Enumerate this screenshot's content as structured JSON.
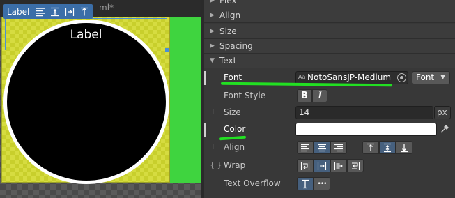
{
  "viewport": {
    "doc_title": "ml*",
    "toolbar_label": "Label",
    "canvas_label": "Label"
  },
  "inspector": {
    "sections": [
      {
        "label": "Flex",
        "expanded": false
      },
      {
        "label": "Align",
        "expanded": false
      },
      {
        "label": "Size",
        "expanded": false
      },
      {
        "label": "Spacing",
        "expanded": false
      },
      {
        "label": "Text",
        "expanded": true
      }
    ],
    "font": {
      "label": "Font",
      "asset_icon_text": "Aa",
      "value": "NotoSansJP-Medium",
      "type_dropdown": "Font"
    },
    "font_style": {
      "label": "Font Style",
      "bold": "B",
      "italic": "I"
    },
    "size": {
      "label": "Size",
      "value": "14",
      "unit": "px"
    },
    "color": {
      "label": "Color",
      "value": "#ffffff"
    },
    "align": {
      "label": "Align"
    },
    "wrap": {
      "label": "Wrap",
      "pin": "{ }"
    },
    "text_overflow": {
      "label": "Text Overflow",
      "ellipsis": "•••"
    }
  },
  "colors": {
    "accent": "#4a8fd6",
    "annotation": "#22e022",
    "active_button": "#46607e"
  }
}
